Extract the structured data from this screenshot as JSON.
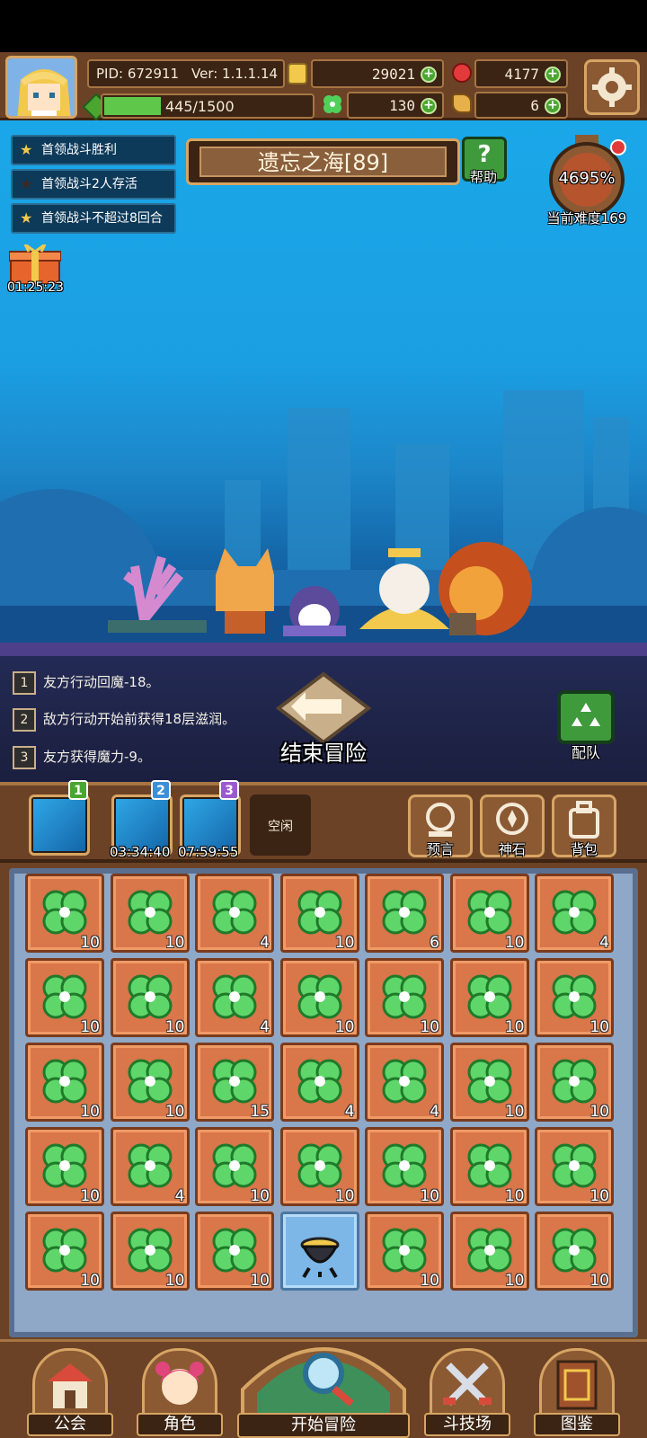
{
  "header": {
    "pid": "PID: 672911",
    "version": "Ver: 1.1.1.14",
    "gold": "29021",
    "gems": "4177",
    "exp": "445/1500",
    "clover": "130",
    "key": "6"
  },
  "quests": [
    {
      "label": "首领战斗胜利",
      "done": true
    },
    {
      "label": "首领战斗2人存活",
      "done": false
    },
    {
      "label": "首领战斗不超过8回合",
      "done": true
    }
  ],
  "gift_timer": "01:25:23",
  "stage": {
    "title": "遗忘之海[89]",
    "help_label": "帮助",
    "difficulty_percent": "4695%",
    "difficulty_label": "当前难度169"
  },
  "logs": [
    {
      "num": "1",
      "text": "友方行动回魔-18。"
    },
    {
      "num": "2",
      "text": "敌方行动开始前获得18层滋润。"
    },
    {
      "num": "3",
      "text": "友方获得魔力-9。"
    }
  ],
  "end_button_label": "结束冒险",
  "team_button_label": "配队",
  "slots": [
    {
      "num": "1",
      "timer": "",
      "color": "#4aa531"
    },
    {
      "num": "2",
      "timer": "03:34:40",
      "color": "#3d8fd6"
    },
    {
      "num": "3",
      "timer": "07:59:55",
      "color": "#9b59d0"
    },
    {
      "num": "",
      "timer": "",
      "label": "空闲"
    }
  ],
  "tools": [
    {
      "label": "预言",
      "icon": "prophecy-icon"
    },
    {
      "label": "神石",
      "icon": "god-stone-icon"
    },
    {
      "label": "背包",
      "icon": "backpack-icon"
    }
  ],
  "inventory": [
    [
      "10",
      "10",
      "4",
      "10",
      "6",
      "10",
      "4"
    ],
    [
      "10",
      "10",
      "4",
      "10",
      "10",
      "10",
      "10"
    ],
    [
      "10",
      "10",
      "15",
      "4",
      "4",
      "10",
      "10"
    ],
    [
      "10",
      "4",
      "10",
      "10",
      "10",
      "10",
      "10"
    ],
    [
      "10",
      "10",
      "10",
      "",
      "10",
      "10",
      "10"
    ]
  ],
  "nav": [
    {
      "label": "公会",
      "icon": "guild-icon"
    },
    {
      "label": "角色",
      "icon": "character-icon"
    },
    {
      "label": "开始冒险",
      "icon": "adventure-icon"
    },
    {
      "label": "斗技场",
      "icon": "arena-icon"
    },
    {
      "label": "图鉴",
      "icon": "codex-icon"
    }
  ]
}
